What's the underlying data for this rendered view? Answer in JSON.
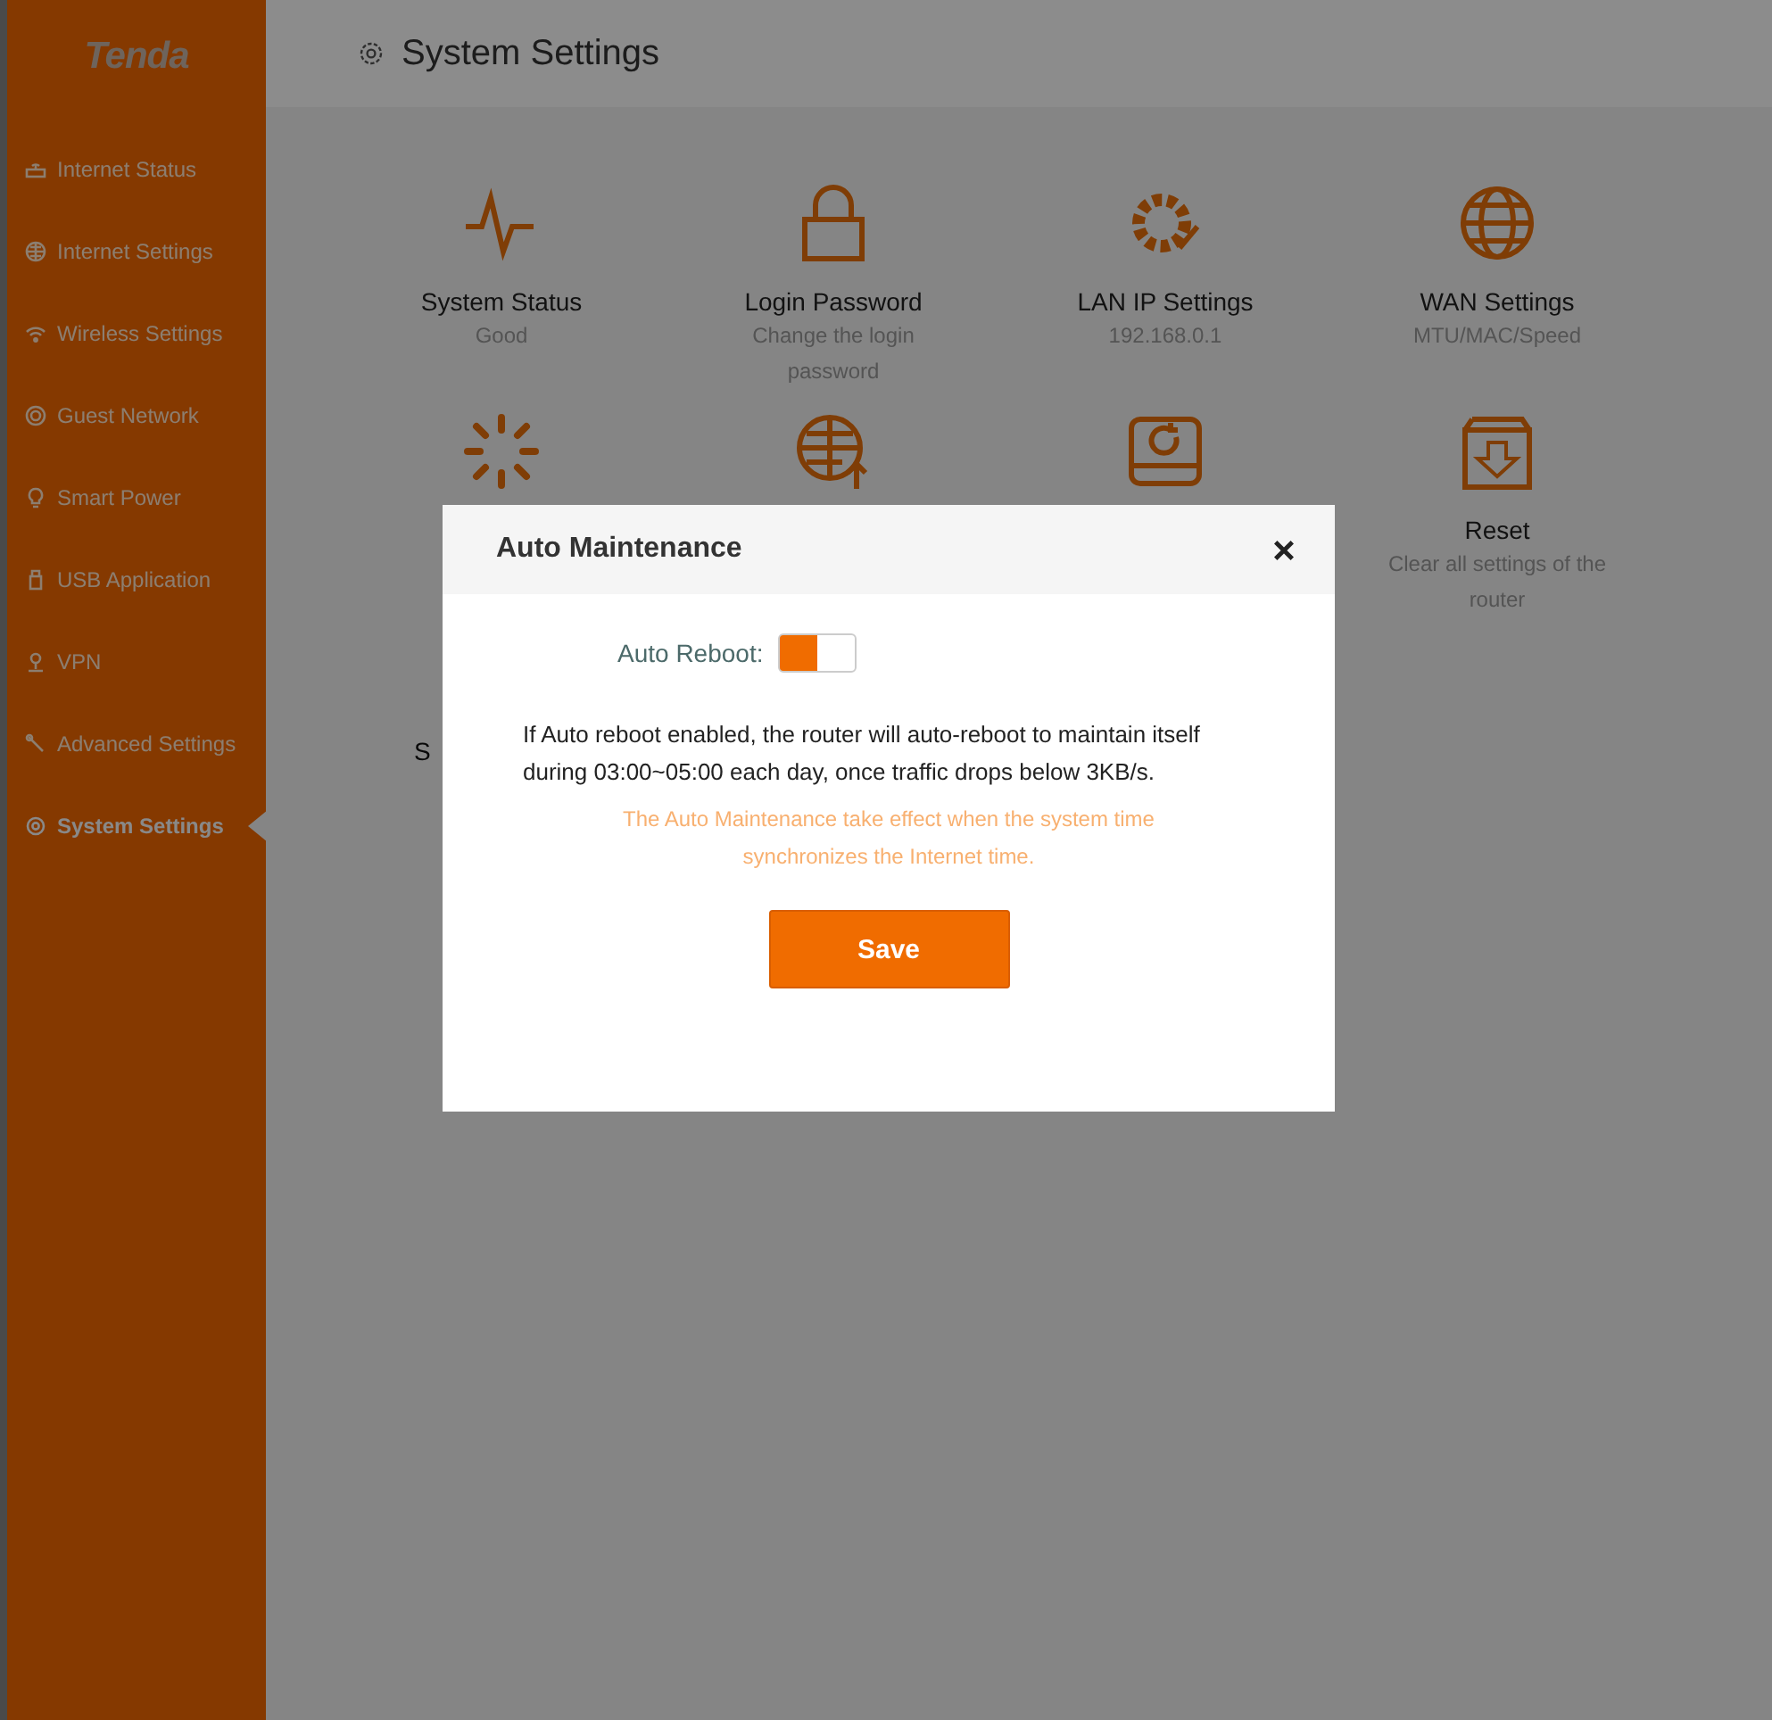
{
  "logo": "Tenda",
  "sidebar": {
    "items": [
      {
        "label": "Internet Status",
        "selected": false
      },
      {
        "label": "Internet Settings",
        "selected": false
      },
      {
        "label": "Wireless Settings",
        "selected": false
      },
      {
        "label": "Guest Network",
        "selected": false
      },
      {
        "label": "Smart Power",
        "selected": false
      },
      {
        "label": "USB Application",
        "selected": false
      },
      {
        "label": "VPN",
        "selected": false
      },
      {
        "label": "Advanced Settings",
        "selected": false
      },
      {
        "label": "System Settings",
        "selected": true
      }
    ]
  },
  "header": {
    "title": "System Settings"
  },
  "tiles": [
    {
      "kind": "tool",
      "title": "System Status",
      "desc": "Good"
    },
    {
      "kind": "tool",
      "title": "Login Password",
      "desc": "Change the login password"
    },
    {
      "kind": "tool",
      "title": "LAN IP Settings",
      "desc": "192.168.0.1"
    },
    {
      "kind": "tool",
      "title": "WAN Settings",
      "desc": "MTU/MAC/Speed"
    },
    {
      "kind": "icon"
    },
    {
      "kind": "icon"
    },
    {
      "kind": "icon"
    },
    {
      "kind": "tool",
      "title": "Reset",
      "desc": "Clear all settings of the router"
    },
    {
      "kind": "label",
      "title": "S"
    }
  ],
  "modal": {
    "title": "Auto Maintenance",
    "toggle_label": "Auto Reboot:",
    "auto_reboot": true,
    "description": "If Auto reboot enabled, the router will auto-reboot to maintain itself during 03:00~05:00 each day, once traffic drops below 3KB/s.",
    "note": "The Auto Maintenance take effect when the system time synchronizes the Internet time.",
    "save": "Save"
  }
}
